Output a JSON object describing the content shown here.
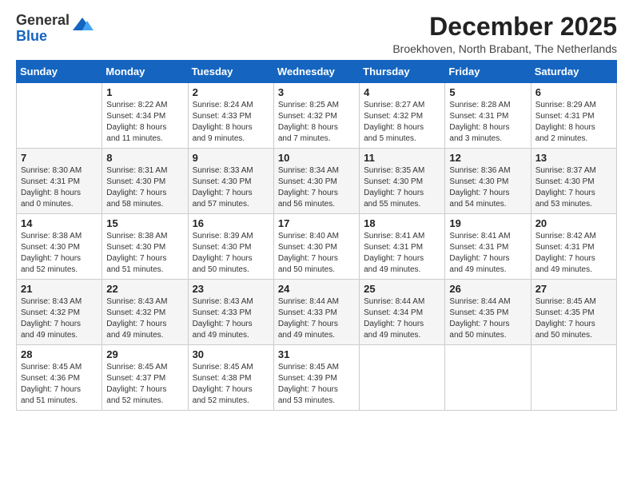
{
  "logo": {
    "general": "General",
    "blue": "Blue"
  },
  "title": "December 2025",
  "location": "Broekhoven, North Brabant, The Netherlands",
  "days_of_week": [
    "Sunday",
    "Monday",
    "Tuesday",
    "Wednesday",
    "Thursday",
    "Friday",
    "Saturday"
  ],
  "weeks": [
    [
      {
        "day": "",
        "info": ""
      },
      {
        "day": "1",
        "info": "Sunrise: 8:22 AM\nSunset: 4:34 PM\nDaylight: 8 hours\nand 11 minutes."
      },
      {
        "day": "2",
        "info": "Sunrise: 8:24 AM\nSunset: 4:33 PM\nDaylight: 8 hours\nand 9 minutes."
      },
      {
        "day": "3",
        "info": "Sunrise: 8:25 AM\nSunset: 4:32 PM\nDaylight: 8 hours\nand 7 minutes."
      },
      {
        "day": "4",
        "info": "Sunrise: 8:27 AM\nSunset: 4:32 PM\nDaylight: 8 hours\nand 5 minutes."
      },
      {
        "day": "5",
        "info": "Sunrise: 8:28 AM\nSunset: 4:31 PM\nDaylight: 8 hours\nand 3 minutes."
      },
      {
        "day": "6",
        "info": "Sunrise: 8:29 AM\nSunset: 4:31 PM\nDaylight: 8 hours\nand 2 minutes."
      }
    ],
    [
      {
        "day": "7",
        "info": "Sunrise: 8:30 AM\nSunset: 4:31 PM\nDaylight: 8 hours\nand 0 minutes."
      },
      {
        "day": "8",
        "info": "Sunrise: 8:31 AM\nSunset: 4:30 PM\nDaylight: 7 hours\nand 58 minutes."
      },
      {
        "day": "9",
        "info": "Sunrise: 8:33 AM\nSunset: 4:30 PM\nDaylight: 7 hours\nand 57 minutes."
      },
      {
        "day": "10",
        "info": "Sunrise: 8:34 AM\nSunset: 4:30 PM\nDaylight: 7 hours\nand 56 minutes."
      },
      {
        "day": "11",
        "info": "Sunrise: 8:35 AM\nSunset: 4:30 PM\nDaylight: 7 hours\nand 55 minutes."
      },
      {
        "day": "12",
        "info": "Sunrise: 8:36 AM\nSunset: 4:30 PM\nDaylight: 7 hours\nand 54 minutes."
      },
      {
        "day": "13",
        "info": "Sunrise: 8:37 AM\nSunset: 4:30 PM\nDaylight: 7 hours\nand 53 minutes."
      }
    ],
    [
      {
        "day": "14",
        "info": "Sunrise: 8:38 AM\nSunset: 4:30 PM\nDaylight: 7 hours\nand 52 minutes."
      },
      {
        "day": "15",
        "info": "Sunrise: 8:38 AM\nSunset: 4:30 PM\nDaylight: 7 hours\nand 51 minutes."
      },
      {
        "day": "16",
        "info": "Sunrise: 8:39 AM\nSunset: 4:30 PM\nDaylight: 7 hours\nand 50 minutes."
      },
      {
        "day": "17",
        "info": "Sunrise: 8:40 AM\nSunset: 4:30 PM\nDaylight: 7 hours\nand 50 minutes."
      },
      {
        "day": "18",
        "info": "Sunrise: 8:41 AM\nSunset: 4:31 PM\nDaylight: 7 hours\nand 49 minutes."
      },
      {
        "day": "19",
        "info": "Sunrise: 8:41 AM\nSunset: 4:31 PM\nDaylight: 7 hours\nand 49 minutes."
      },
      {
        "day": "20",
        "info": "Sunrise: 8:42 AM\nSunset: 4:31 PM\nDaylight: 7 hours\nand 49 minutes."
      }
    ],
    [
      {
        "day": "21",
        "info": "Sunrise: 8:43 AM\nSunset: 4:32 PM\nDaylight: 7 hours\nand 49 minutes."
      },
      {
        "day": "22",
        "info": "Sunrise: 8:43 AM\nSunset: 4:32 PM\nDaylight: 7 hours\nand 49 minutes."
      },
      {
        "day": "23",
        "info": "Sunrise: 8:43 AM\nSunset: 4:33 PM\nDaylight: 7 hours\nand 49 minutes."
      },
      {
        "day": "24",
        "info": "Sunrise: 8:44 AM\nSunset: 4:33 PM\nDaylight: 7 hours\nand 49 minutes."
      },
      {
        "day": "25",
        "info": "Sunrise: 8:44 AM\nSunset: 4:34 PM\nDaylight: 7 hours\nand 49 minutes."
      },
      {
        "day": "26",
        "info": "Sunrise: 8:44 AM\nSunset: 4:35 PM\nDaylight: 7 hours\nand 50 minutes."
      },
      {
        "day": "27",
        "info": "Sunrise: 8:45 AM\nSunset: 4:35 PM\nDaylight: 7 hours\nand 50 minutes."
      }
    ],
    [
      {
        "day": "28",
        "info": "Sunrise: 8:45 AM\nSunset: 4:36 PM\nDaylight: 7 hours\nand 51 minutes."
      },
      {
        "day": "29",
        "info": "Sunrise: 8:45 AM\nSunset: 4:37 PM\nDaylight: 7 hours\nand 52 minutes."
      },
      {
        "day": "30",
        "info": "Sunrise: 8:45 AM\nSunset: 4:38 PM\nDaylight: 7 hours\nand 52 minutes."
      },
      {
        "day": "31",
        "info": "Sunrise: 8:45 AM\nSunset: 4:39 PM\nDaylight: 7 hours\nand 53 minutes."
      },
      {
        "day": "",
        "info": ""
      },
      {
        "day": "",
        "info": ""
      },
      {
        "day": "",
        "info": ""
      }
    ]
  ]
}
